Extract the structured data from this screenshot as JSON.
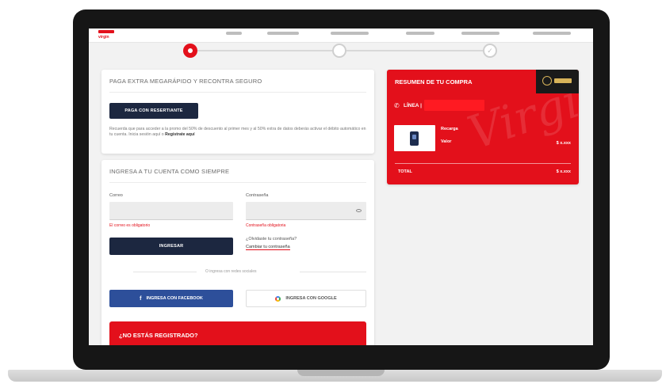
{
  "brand": {
    "logo_sub": "virgin",
    "accent": "#e3101b",
    "navy": "#1c2740",
    "facebook": "#2d4f9a"
  },
  "stepper": {
    "current_step": 1,
    "total_steps": 3
  },
  "card_recharge": {
    "title": "PAGA EXTRA MEGARÁPIDO Y RECONTRA SEGURO",
    "button": "PAGA CON RESERTIANTE",
    "text": "Recuerda que para acceder a la promo del 50% de descuento al primer mes y al 50% extra de datos deberás activar el débito automático en tu cuenta. Inicia sesión aquí o",
    "text_link": "Regístrate aquí"
  },
  "card_login": {
    "title": "INGRESA A TU CUENTA COMO SIEMPRE",
    "email_label": "Correo",
    "email_error": "El correo es obligatorio",
    "password_label": "Contraseña",
    "password_error": "Contraseña obligatoria",
    "login_button": "INGRESAR",
    "forgot_question": "¿Olvidaste tu contraseña?",
    "forgot_link": "Cambiar tu contraseña",
    "or_text": "O ingresa con redes sociales",
    "facebook_button": "INGRESA CON FACEBOOK",
    "google_button": "INGRESA CON GOOGLE"
  },
  "register_banner": {
    "title": "¿NO ESTÁS REGISTRADO?"
  },
  "summary": {
    "title": "RESUMEN DE TU COMPRA",
    "watermark": "Virgin",
    "line_label": "LÍNEA |",
    "product_line1": "Recarga",
    "product_line2": "Valor",
    "product_price": "$ x.xxx",
    "total_label": "TOTAL",
    "total_value": "$ x.xxx"
  },
  "icons": {
    "phone": "phone-icon",
    "eye": "eye-icon",
    "facebook": "facebook-icon",
    "google": "google-icon"
  }
}
